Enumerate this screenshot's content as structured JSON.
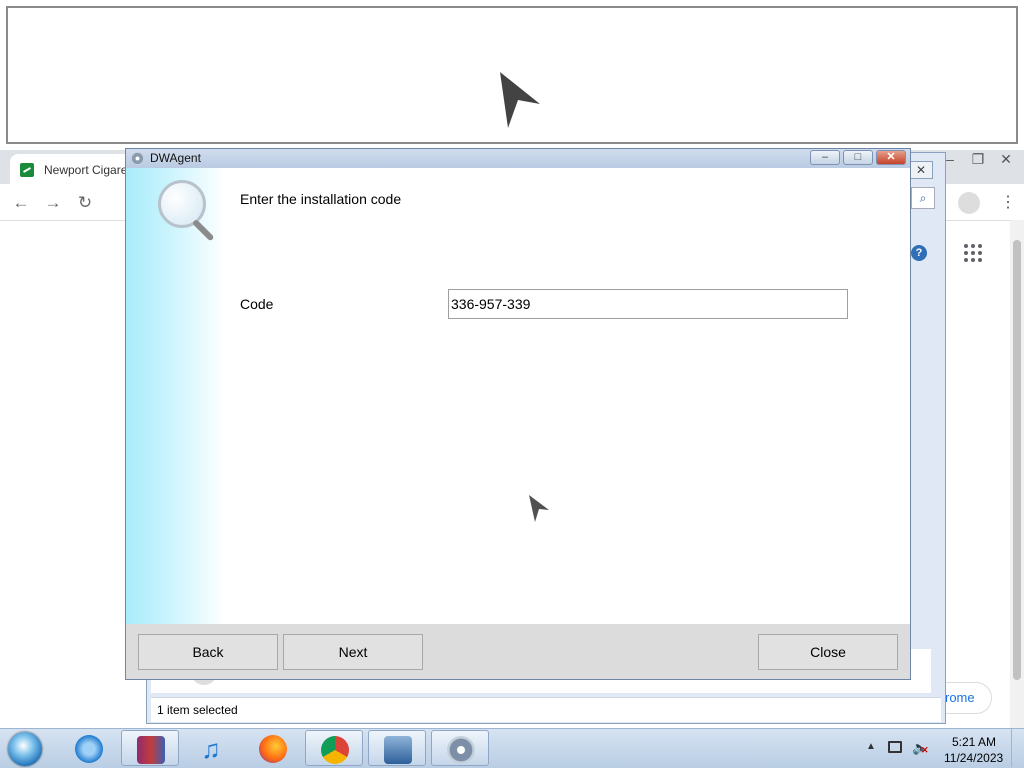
{
  "browser": {
    "tab_title": "Newport Cigare",
    "pill_text": "rome"
  },
  "explorer": {
    "status_text": "1 item selected",
    "search_icon": "search-icon",
    "help_icon": "?"
  },
  "dialog": {
    "title": "DWAgent",
    "heading": "Enter the installation code",
    "code_label": "Code",
    "code_value": "336-957-339",
    "buttons": {
      "back": "Back",
      "next": "Next",
      "close": "Close"
    },
    "window_buttons": {
      "minimize": "–",
      "maximize": "□",
      "close": "✕"
    }
  },
  "taskbar": {
    "items": [
      "start-orb",
      "internet-explorer-icon",
      "winrar-icon",
      "itunes-icon",
      "firefox-icon",
      "chrome-icon",
      "remote-desktop-icon",
      "dwagent-icon"
    ],
    "clock_time": "5:21 AM",
    "clock_date": "11/24/2023"
  },
  "colors": {
    "side_gradient": "#a8ecfb",
    "dialog_footer": "#dcdcdc",
    "taskbar": "#c8d9ec"
  }
}
